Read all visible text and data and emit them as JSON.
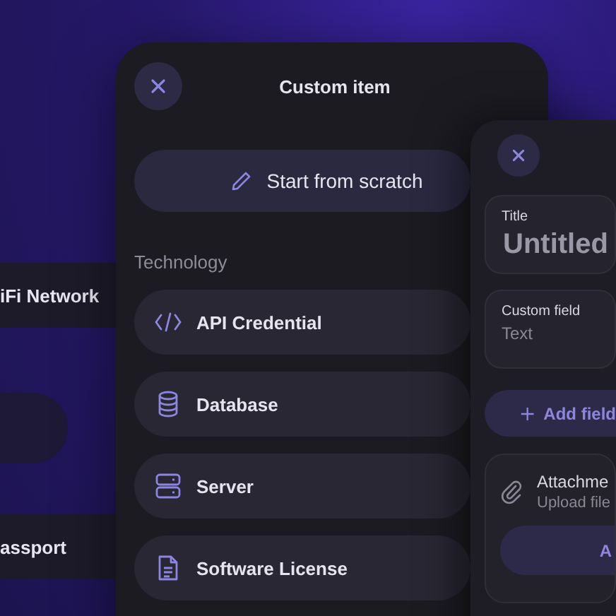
{
  "back_panel": {
    "items": [
      {
        "label": "iFi Network",
        "kind": "row"
      },
      {
        "kind": "pill"
      },
      {
        "label": "assport",
        "kind": "row"
      }
    ]
  },
  "custom_item_dialog": {
    "title": "Custom item",
    "start_button": "Start from scratch",
    "section": "Technology",
    "items": [
      {
        "label": "API Credential"
      },
      {
        "label": "Database"
      },
      {
        "label": "Server"
      },
      {
        "label": "Software License"
      }
    ]
  },
  "editor": {
    "title_field": {
      "label": "Title",
      "value": "Untitled"
    },
    "custom_field": {
      "label": "Custom field",
      "placeholder": "Text"
    },
    "add_field_button": "Add field",
    "attachment": {
      "title": "Attachme",
      "subtitle": "Upload file",
      "button": "A"
    }
  }
}
